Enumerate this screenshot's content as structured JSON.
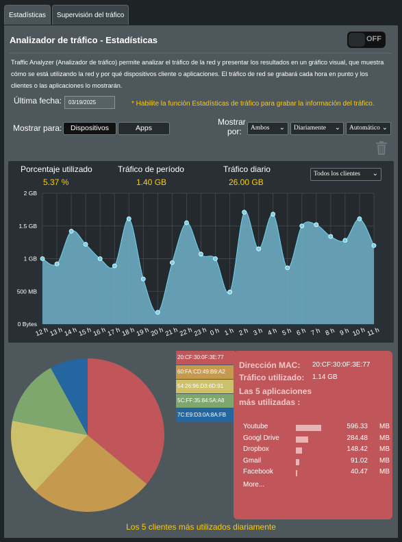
{
  "tabs": [
    {
      "label": "Estadísticas"
    },
    {
      "label": "Supervisión del tráfico"
    }
  ],
  "header": {
    "title": "Analizador de tráfico - Estadísticas",
    "toggle_label": "OFF"
  },
  "description": "Traffic Analyzer (Analizador de tráfico) permite analizar el tráfico de la red y presentar los resultados en un gráfico visual, que muestra cómo se está utilizando la red y por qué dispositivos cliente o aplicaciones. El tráfico de red se grabará cada hora en punto y los clientes o las aplicaciones lo mostrarán.",
  "last_date": {
    "label": "Última fecha:",
    "value": "03/19/2025"
  },
  "note": "* Habilite la función Estadísticas de tráfico para grabar la información del tráfico.",
  "show_for": {
    "label": "Mostrar para:",
    "buttons": [
      "Dispositivos",
      "Apps"
    ]
  },
  "show_by": {
    "label_line1": "Mostrar",
    "label_line2": "por:",
    "selects": [
      "Ambos",
      "Diariamente",
      "Automático"
    ]
  },
  "stats": {
    "pct_label": "Porcentaje utilizado",
    "pct_value": "5.37 %",
    "period_label": "Tráfico de período",
    "period_value": "1.40 GB",
    "daily_label": "Tráfico diario",
    "daily_value": "26.00 GB",
    "clients_select": "Todos los clientes"
  },
  "chart_data": {
    "type": "area",
    "y_tick_labels": [
      "2 GB",
      "1.5 GB",
      "1 GB",
      "500 MB",
      "0 Bytes"
    ],
    "ylim": [
      0,
      2
    ],
    "x_tick_labels": [
      "12 h",
      "13 h",
      "14 h",
      "15 h",
      "16 h",
      "17 h",
      "18 h",
      "19 h",
      "20 h",
      "21 h",
      "22 h",
      "23 h",
      "0 h",
      "1 h",
      "2 h",
      "3 h",
      "4 h",
      "5 h",
      "6 h",
      "7 h",
      "8 h",
      "9 h",
      "10 h",
      "11 h"
    ],
    "values": [
      1.0,
      0.92,
      1.42,
      1.22,
      1.0,
      0.89,
      1.61,
      0.69,
      0.18,
      0.94,
      1.55,
      1.07,
      1.0,
      0.49,
      1.71,
      1.15,
      1.68,
      0.86,
      1.5,
      1.52,
      1.34,
      1.28,
      1.61,
      1.2
    ],
    "grid": true,
    "colors": {
      "fill": "#6ba8be",
      "line": "#6fd3ef",
      "point": "#6fd3ef"
    }
  },
  "pie": {
    "slices": [
      {
        "mac": "20:CF:30:0F:3E:77",
        "value": 36,
        "color": "#c0565a"
      },
      {
        "mac": "60:FA:CD:49:B9:A2",
        "value": 26,
        "color": "#c69a4e"
      },
      {
        "mac": "54:26:96:D3:6D:91",
        "value": 16,
        "color": "#cdc06b"
      },
      {
        "mac": "5C:FF:35:84:5A:A8",
        "value": 14,
        "color": "#7ea76e"
      },
      {
        "mac": "7C:E9:D3:0A:8A:FB",
        "value": 8,
        "color": "#2466a0"
      }
    ]
  },
  "info": {
    "mac_label": "Dirección MAC:",
    "mac_value": "20:CF:30:0F:3E:77",
    "traffic_label": "Tráfico utilizado:",
    "traffic_value": "1.14 GB",
    "top_apps_title": "Las 5 aplicaciones más utilizadas :",
    "apps": [
      {
        "name": "Youtube",
        "value": "596.33",
        "unit": "MB",
        "ratio": 0.62
      },
      {
        "name": "Googl Drive",
        "value": "284.48",
        "unit": "MB",
        "ratio": 0.3
      },
      {
        "name": "Dropbox",
        "value": "148.42",
        "unit": "MB",
        "ratio": 0.15
      },
      {
        "name": "Gmail",
        "value": "91.02",
        "unit": "MB",
        "ratio": 0.09
      },
      {
        "name": "Facebook",
        "value": "40.47",
        "unit": "MB",
        "ratio": 0.04
      }
    ],
    "more_label": "More..."
  },
  "footer_note": "Los 5 clientes más utilizados diariamente"
}
